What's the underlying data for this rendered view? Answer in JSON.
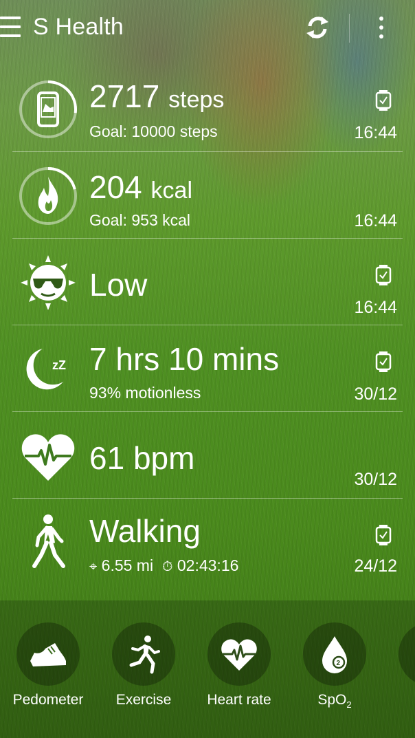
{
  "header": {
    "title": "S Health",
    "icons": [
      "menu-icon",
      "sync-icon",
      "more-options-icon"
    ]
  },
  "rows": [
    {
      "icon": "watch-steps-icon",
      "value": "2717",
      "unit": "steps",
      "sub": "Goal: 10000 steps",
      "time": "16:44",
      "source_icon": "watch-icon",
      "progress": 0.27
    },
    {
      "icon": "flame-icon",
      "value": "204",
      "unit": "kcal",
      "sub": "Goal: 953 kcal",
      "time": "16:44",
      "source_icon": null,
      "progress": 0.21
    },
    {
      "icon": "uv-sun-icon",
      "value": "Low",
      "time": "16:44",
      "source_icon": "watch-icon"
    },
    {
      "icon": "sleep-moon-icon",
      "value": "7 hrs 10 mins",
      "sub": "93% motionless",
      "time": "30/12",
      "source_icon": "watch-icon"
    },
    {
      "icon": "heart-rate-icon",
      "value": "61 bpm",
      "time": "30/12",
      "source_icon": null
    },
    {
      "icon": "walking-icon",
      "value": "Walking",
      "distance": "6.55 mi",
      "duration": "02:43:16",
      "time": "24/12",
      "source_icon": "watch-icon"
    }
  ],
  "shortcuts": [
    {
      "label": "Pedometer",
      "icon": "shoe-icon"
    },
    {
      "label": "Exercise",
      "icon": "running-icon"
    },
    {
      "label": "Heart rate",
      "icon": "heart-rate-icon"
    },
    {
      "label": "SpO",
      "label_sub": "2",
      "icon": "spo2-icon"
    }
  ]
}
